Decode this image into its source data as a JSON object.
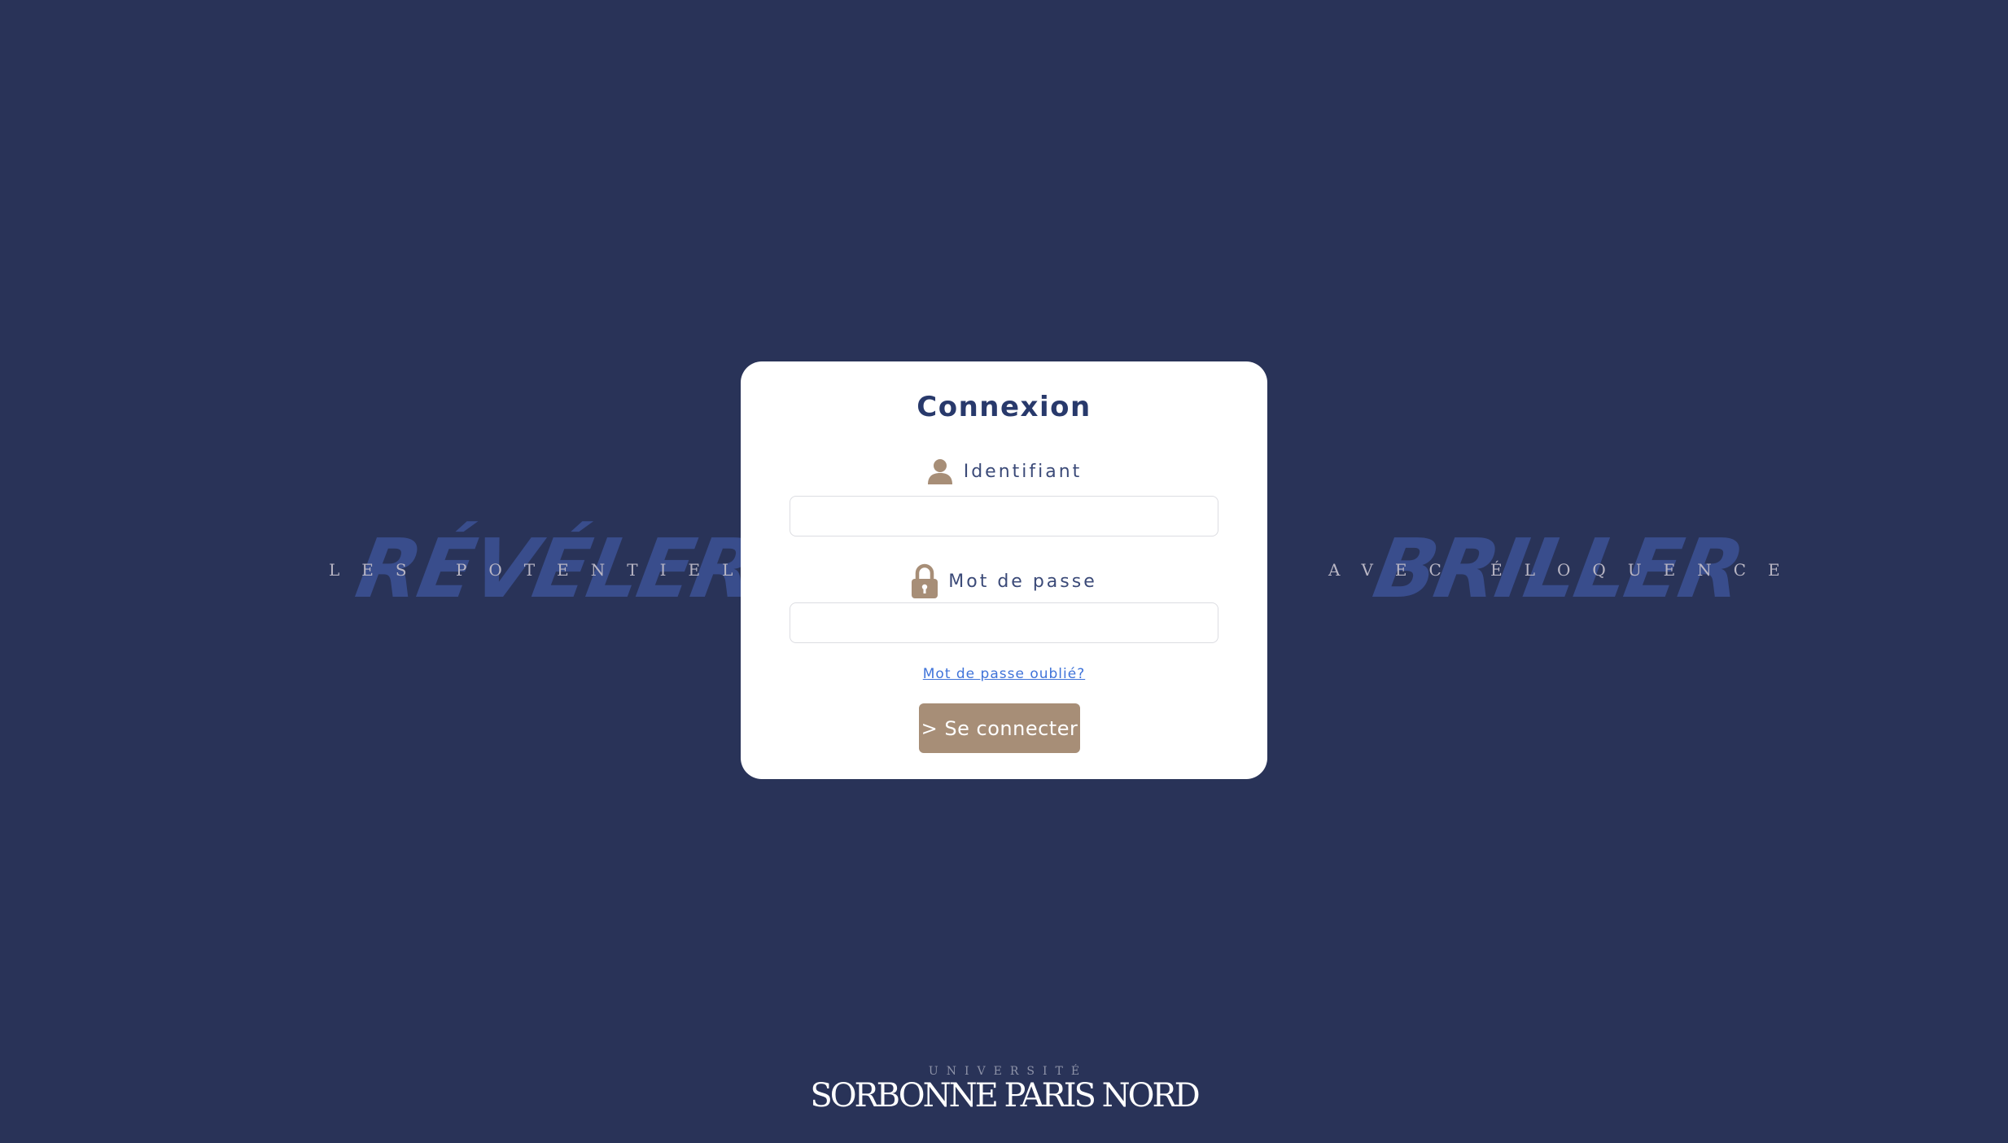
{
  "background_color": "#293358",
  "left_slogan": {
    "brush_text": "RÉVÉLER",
    "spaced_text": "LES POTENTIELS"
  },
  "right_slogan": {
    "brush_text": "BRILLER",
    "spaced_text": "AVEC ÉLOQUENCE"
  },
  "login": {
    "title": "Connexion",
    "username_label": "Identifiant",
    "username_icon": "user-icon",
    "username_value": "",
    "password_label": "Mot de passe",
    "password_icon": "lock-icon",
    "password_value": "",
    "forgot_link": "Mot de passe oublié?",
    "submit_label": "> Se connecter",
    "accent_color": "#a78e77",
    "title_color": "#28396b",
    "link_color": "#3f73d9"
  },
  "footer": {
    "logo_top": "UNIVERSITÉ",
    "logo_main": "SORBONNE PARIS NORD"
  }
}
